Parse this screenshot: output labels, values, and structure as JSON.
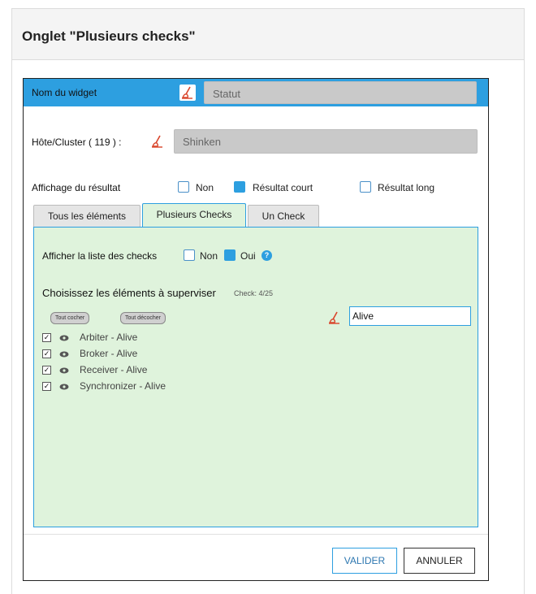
{
  "doc": {
    "title": "Onglet \"Plusieurs checks\""
  },
  "widget": {
    "label": "Nom du widget",
    "name_value": "Statut"
  },
  "host": {
    "label": "Hôte/Cluster ( 119 ) :",
    "value": "Shinken"
  },
  "display": {
    "label": "Affichage du résultat",
    "options": [
      {
        "label": "Non",
        "checked": false
      },
      {
        "label": "Résultat court",
        "checked": true
      },
      {
        "label": "Résultat long",
        "checked": false
      }
    ]
  },
  "tabs": [
    {
      "label": "Tous les éléments",
      "active": false
    },
    {
      "label": "Plusieurs Checks",
      "active": true
    },
    {
      "label": "Un Check",
      "active": false
    }
  ],
  "panel": {
    "show_list_label": "Afficher la liste des checks",
    "non_label": "Non",
    "oui_label": "Oui",
    "help_glyph": "?",
    "section_title": "Choisissez les éléments à superviser",
    "count": "Check: 4/25",
    "check_all": "Tout cocher",
    "uncheck_all": "Tout décocher",
    "filter_value": "Alive",
    "items": [
      {
        "label": "Arbiter - Alive",
        "checked": true
      },
      {
        "label": "Broker - Alive",
        "checked": true
      },
      {
        "label": "Receiver - Alive",
        "checked": true
      },
      {
        "label": "Synchronizer - Alive",
        "checked": true
      }
    ]
  },
  "buttons": {
    "validate": "VALIDER",
    "cancel": "ANNULER"
  },
  "colors": {
    "accent": "#2d9fe0",
    "panel_bg": "#dff3dc",
    "brush": "#d9452b"
  },
  "icons": {
    "clear": "broom-icon",
    "help": "help-icon",
    "view": "eye-icon",
    "check": "checkmark"
  }
}
